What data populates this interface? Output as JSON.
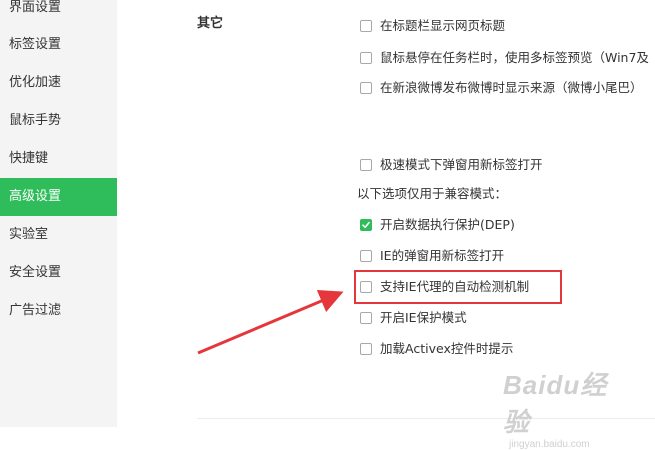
{
  "sidebar": {
    "items": [
      {
        "label": "界面设置",
        "active": false
      },
      {
        "label": "标签设置",
        "active": false
      },
      {
        "label": "优化加速",
        "active": false
      },
      {
        "label": "鼠标手势",
        "active": false
      },
      {
        "label": "快捷键",
        "active": false
      },
      {
        "label": "高级设置",
        "active": true
      },
      {
        "label": "实验室",
        "active": false
      },
      {
        "label": "安全设置",
        "active": false
      },
      {
        "label": "广告过滤",
        "active": false
      }
    ]
  },
  "main": {
    "section_title": "其它",
    "options_top": [
      {
        "label": "在标题栏显示网页标题",
        "checked": false
      },
      {
        "label": "鼠标悬停在任务栏时，使用多标签预览（Win7及",
        "checked": false
      },
      {
        "label": "在新浪微博发布微博时显示来源（微博小尾巴）",
        "checked": false
      },
      {
        "label": "极速模式下弹窗用新标签打开",
        "checked": false
      }
    ],
    "compat_note": "以下选项仅用于兼容模式：",
    "options_compat": [
      {
        "label": "开启数据执行保护(DEP)",
        "checked": true
      },
      {
        "label": "IE的弹窗用新标签打开",
        "checked": false
      },
      {
        "label": "支持IE代理的自动检测机制",
        "checked": false
      },
      {
        "label": "开启IE保护模式",
        "checked": false
      },
      {
        "label": "加载Activex控件时提示",
        "checked": false
      }
    ]
  },
  "annotation": {
    "color": "#e5373b"
  },
  "watermark": {
    "brand": "Baidu经验",
    "url": "jingyan.baidu.com"
  },
  "colors": {
    "accent": "#2fbd5b",
    "sidebar_bg": "#f4f4f4",
    "annotation": "#e5373b"
  }
}
